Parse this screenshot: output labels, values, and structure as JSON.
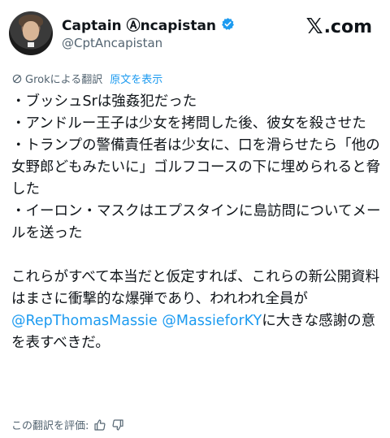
{
  "author": {
    "display_name": "Captain Ⓐncapistan",
    "handle": "@CptAncapistan"
  },
  "brand": {
    "label": "X.com",
    "x_glyph": "𝕏",
    "suffix": ".com"
  },
  "translation": {
    "provider_label": "Grokによる翻訳",
    "show_original": "原文を表示"
  },
  "tweet": {
    "line1": "・ブッシュSrは強姦犯だった",
    "line2": "・アンドルー王子は少女を拷問した後、彼女を殺させた",
    "line3": "・トランプの警備責任者は少女に、口を滑らせたら「他の女野郎どもみたいに」ゴルフコースの下に埋められると脅した",
    "line4": "・イーロン・マスクはエプスタインに島訪問についてメールを送った",
    "para2_start": "これらがすべて本当だと仮定すれば、これらの新公開資料はまさに衝撃的な爆弾であり、われわれ全員が",
    "mention1": "@RepThomasMassie",
    "mention2": "@MassieforKY",
    "para2_end": "に大きな感謝の意を表すべきだ。"
  },
  "rating": {
    "label": "この翻訳を評価:"
  },
  "icons": {
    "verified": "verified-badge-icon",
    "grok": "grok-icon",
    "thumb_up": "thumbs-up-icon",
    "thumb_down": "thumbs-down-icon"
  },
  "colors": {
    "link": "#1d9bf0",
    "secondary": "#536471",
    "text": "#0f1419"
  }
}
